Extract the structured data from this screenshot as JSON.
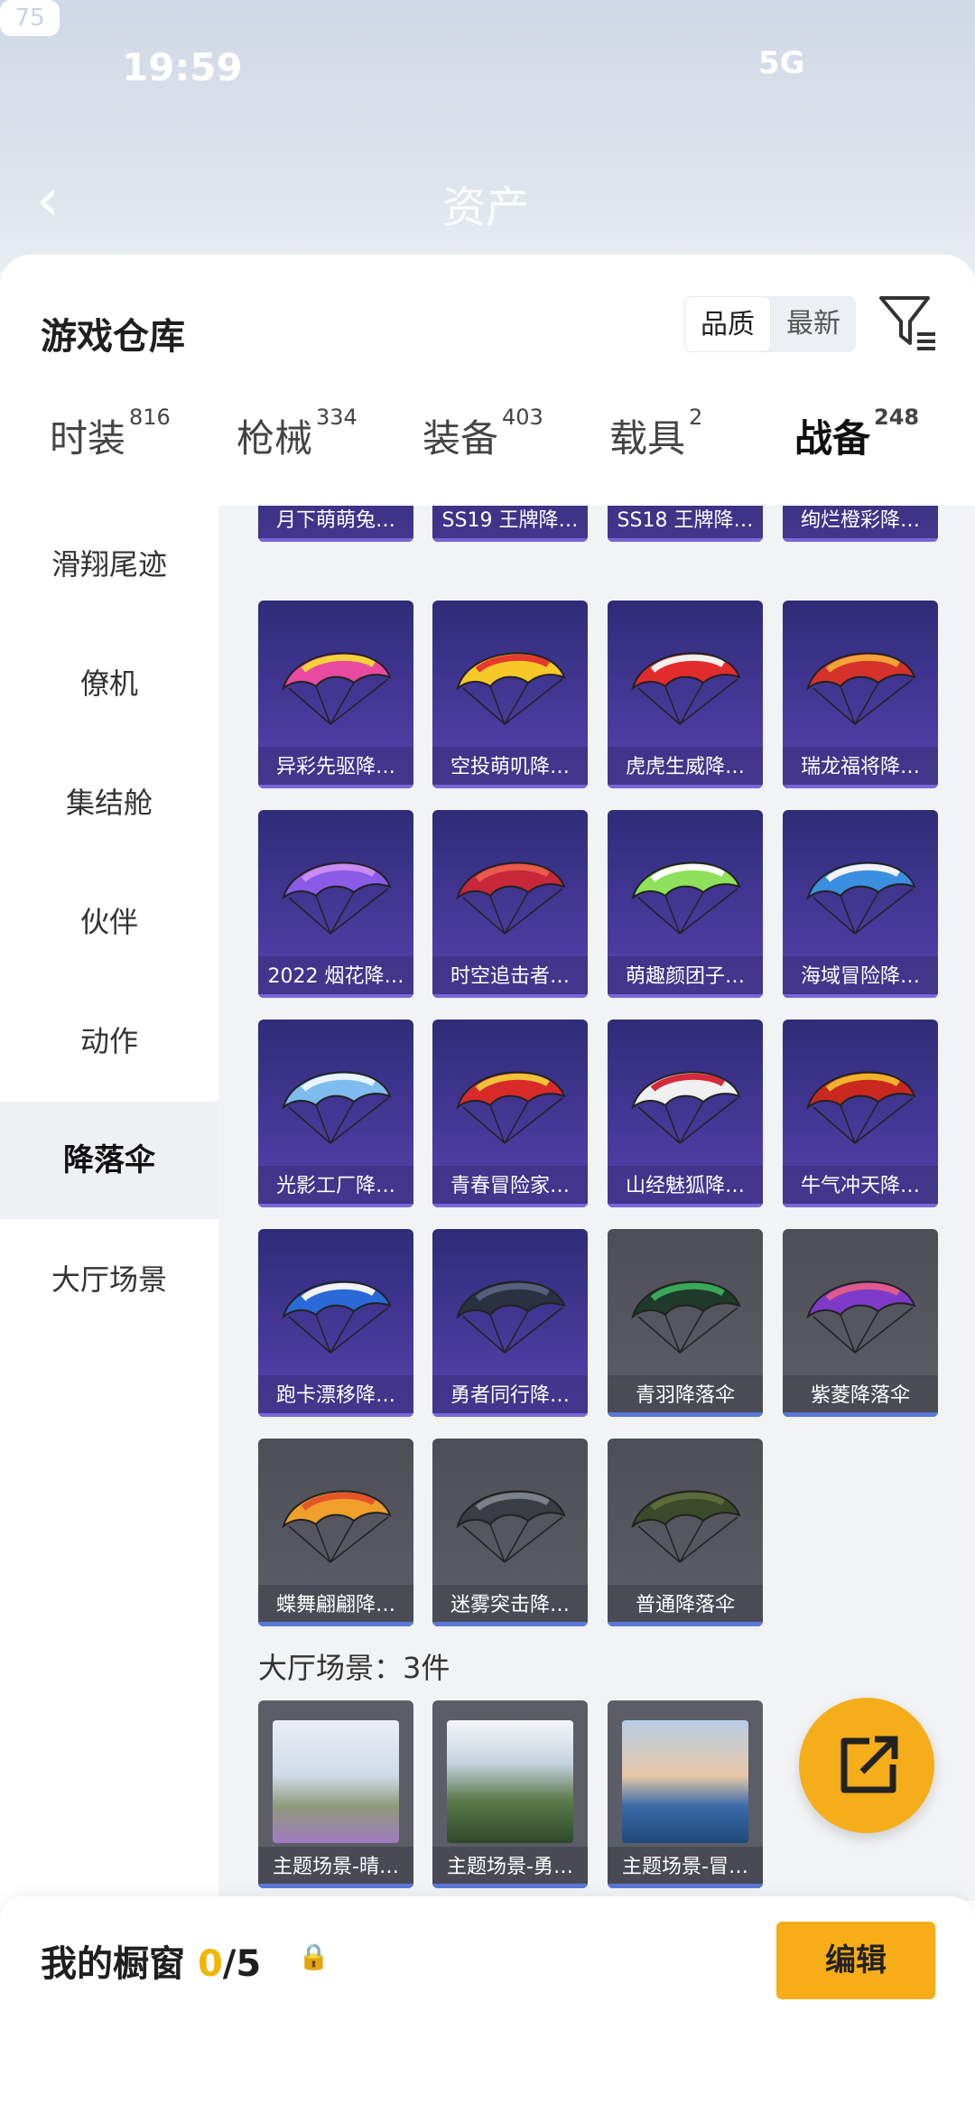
{
  "status": {
    "time": "19:59",
    "network": "5G",
    "battery": "75"
  },
  "nav": {
    "title": "资产"
  },
  "header": {
    "title": "游戏仓库",
    "sort_options": [
      "品质",
      "最新"
    ]
  },
  "tabs": [
    {
      "label": "时装",
      "count": "816"
    },
    {
      "label": "枪械",
      "count": "334"
    },
    {
      "label": "装备",
      "count": "403"
    },
    {
      "label": "载具",
      "count": "2"
    },
    {
      "label": "战备",
      "count": "248"
    }
  ],
  "sidebar": [
    "滑翔尾迹",
    "僚机",
    "集结舱",
    "伙伴",
    "动作",
    "降落伞",
    "大厅场景"
  ],
  "cards_row0": [
    "月下萌萌兔…",
    "SS19 王牌降…",
    "SS18 王牌降…",
    "绚烂橙彩降…"
  ],
  "cards": [
    "异彩先驱降…",
    "空投萌叽降…",
    "虎虎生威降…",
    "瑞龙福将降…",
    "2022 烟花降…",
    "时空追击者…",
    "萌趣颜团子…",
    "海域冒险降…",
    "光影工厂降…",
    "青春冒险家…",
    "山经魅狐降…",
    "牛气冲天降…",
    "跑卡漂移降…",
    "勇者同行降…",
    "青羽降落伞",
    "紫菱降落伞",
    "蝶舞翩翩降…",
    "迷雾突击降…",
    "普通降落伞"
  ],
  "section": {
    "label": "大厅场景：3件"
  },
  "scenes": [
    "主题场景-晴…",
    "主题场景-勇…",
    "主题场景-冒…"
  ],
  "showcase": {
    "label": "我的橱窗",
    "current": "0",
    "total": "/5",
    "edit": "编辑"
  },
  "colors": {
    "accent": "#f5ad1a",
    "card_purple": "#3a3290",
    "card_gray": "#555861"
  }
}
